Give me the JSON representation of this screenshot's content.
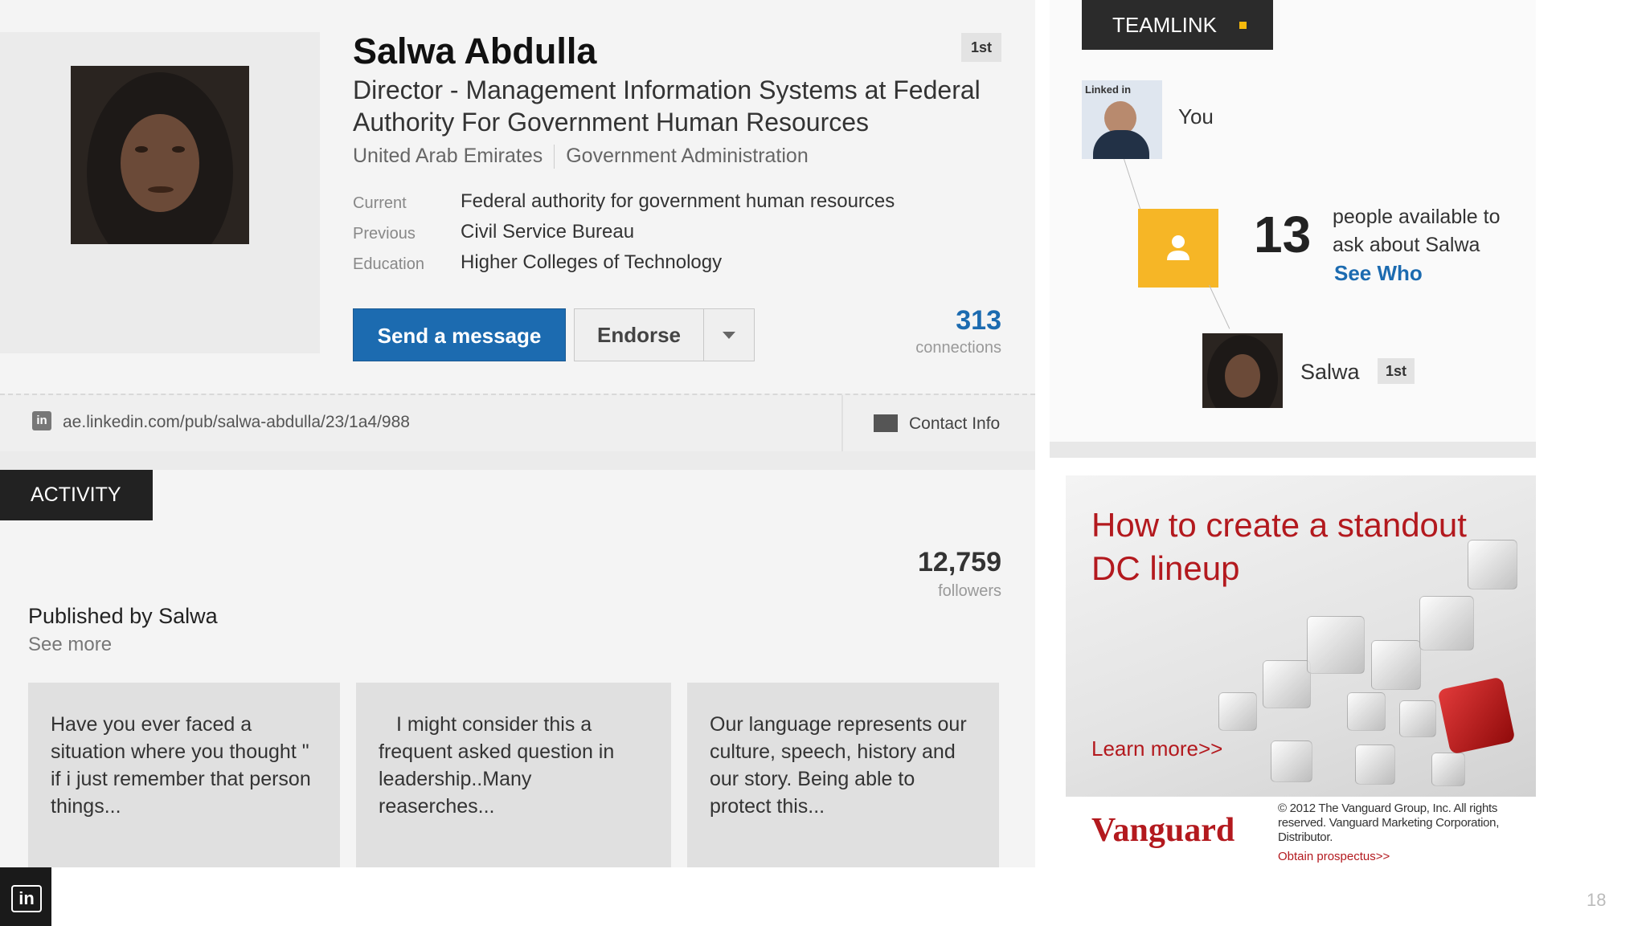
{
  "profile": {
    "name": "Salwa Abdulla",
    "degree": "1st",
    "headline": "Director - Management Information Systems at Federal Authority For Government Human Resources",
    "location": "United Arab Emirates",
    "industry": "Government Administration",
    "facts": [
      {
        "label": "Current",
        "value": "Federal authority for government human resources"
      },
      {
        "label": "Previous",
        "value": "Civil Service Bureau"
      },
      {
        "label": "Education",
        "value": "Higher Colleges of Technology"
      }
    ],
    "send_message_label": "Send a message",
    "endorse_label": "Endorse",
    "connections_count": "313",
    "connections_label": "connections",
    "public_url": "ae.linkedin.com/pub/salwa-abdulla/23/1a4/988",
    "contact_info_label": "Contact Info"
  },
  "activity": {
    "tab_label": "ACTIVITY",
    "followers_count": "12,759",
    "followers_label": "followers",
    "published_title": "Published by Salwa",
    "see_more_label": "See more",
    "posts": [
      {
        "text": "Have you ever faced a situation where you thought \" if i just remember that person things..."
      },
      {
        "text": "I might consider this a frequent asked question in leadership..Many reaserches..."
      },
      {
        "text": "Our language represents our culture, speech, history and our story. Being able to protect this..."
      }
    ]
  },
  "teamlink": {
    "tab_label": "TEAMLINK",
    "you_label": "You",
    "linkedin_badge": "Linked in",
    "people_count": "13",
    "people_text": "people available to ask about Salwa",
    "see_who_label": "See Who",
    "target_name": "Salwa",
    "target_degree": "1st",
    "accent_color": "#f6b626"
  },
  "ad": {
    "headline": "How to create a standout DC lineup",
    "learn_more_label": "Learn more>>",
    "brand": "Vanguard",
    "legal_text": "© 2012 The Vanguard Group, Inc. All rights reserved. Vanguard Marketing Corporation, Distributor.",
    "prospectus_label": "Obtain prospectus>>",
    "brand_color": "#b3191e"
  },
  "slide": {
    "page_number": "18",
    "corner_logo_text": "in"
  },
  "icons": [
    "linkedin-icon",
    "contact-card-icon",
    "person-icon",
    "caret-down-icon"
  ],
  "colors": {
    "link_blue": "#1c6bb0",
    "dark_tab": "#222222"
  }
}
